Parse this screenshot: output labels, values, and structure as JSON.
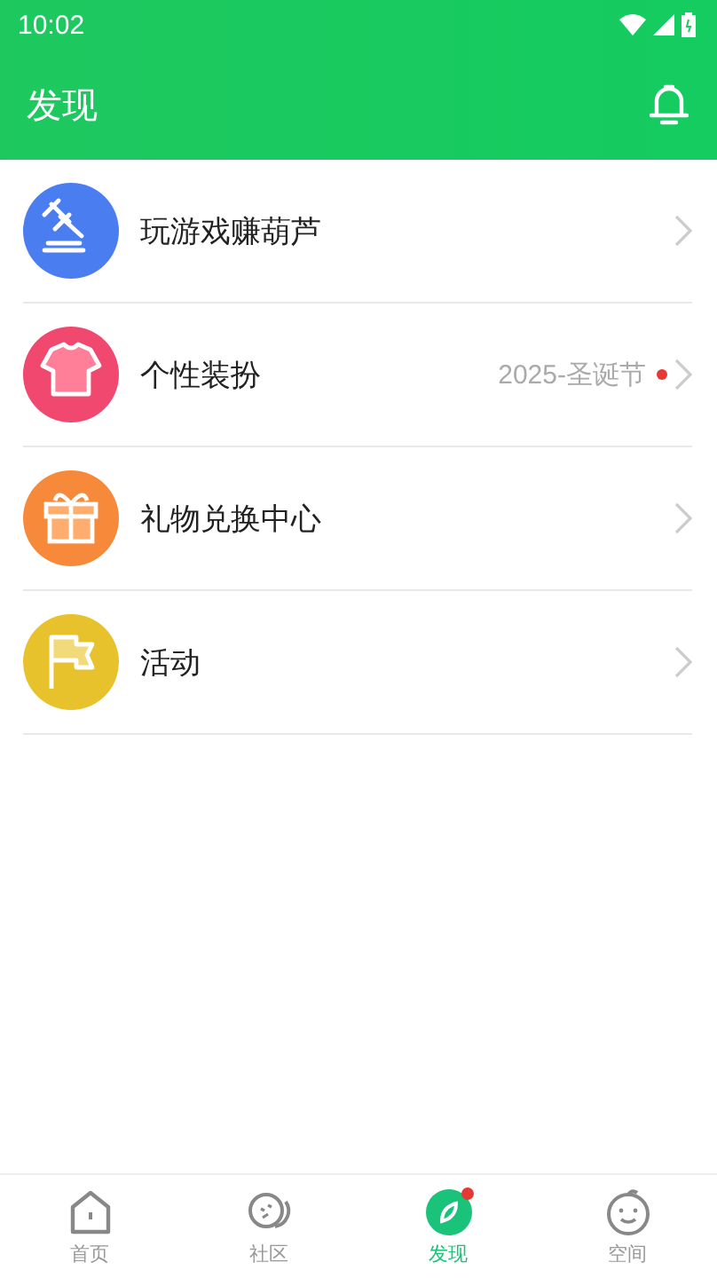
{
  "status_bar": {
    "time": "10:02"
  },
  "header": {
    "title": "发现"
  },
  "items": [
    {
      "label": "玩游戏赚葫芦",
      "kind": "gavel",
      "color": "#4a7ef0"
    },
    {
      "label": "个性装扮",
      "kind": "shirt",
      "color": "#f0486e",
      "note": "2025-圣诞节",
      "dot": true
    },
    {
      "label": "礼物兑换中心",
      "kind": "gift",
      "color": "#f78a3a"
    },
    {
      "label": "活动",
      "kind": "flag",
      "color": "#e8c22c"
    }
  ],
  "tabs": [
    {
      "label": "首页",
      "kind": "home",
      "selected": false,
      "dot": false
    },
    {
      "label": "社区",
      "kind": "community",
      "selected": false,
      "dot": false
    },
    {
      "label": "发现",
      "kind": "discover",
      "selected": true,
      "dot": true
    },
    {
      "label": "空间",
      "kind": "space",
      "selected": false,
      "dot": false
    }
  ]
}
